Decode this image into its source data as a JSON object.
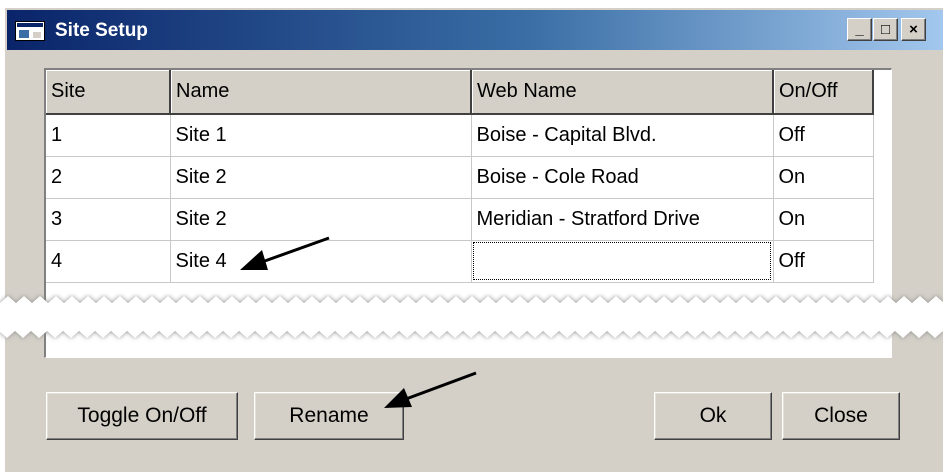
{
  "window": {
    "title": "Site Setup",
    "icon": "app-window-icon",
    "controls": {
      "minimize": "_",
      "maximize": "□",
      "close": "×"
    }
  },
  "grid": {
    "columns": [
      "Site",
      "Name",
      "Web Name",
      "On/Off"
    ],
    "rows": [
      {
        "site": "1",
        "name": "Site 1",
        "web_name": "Boise - Capital Blvd.",
        "on_off": "Off"
      },
      {
        "site": "2",
        "name": "Site 2",
        "web_name": "Boise - Cole Road",
        "on_off": "On"
      },
      {
        "site": "3",
        "name": "Site 2",
        "web_name": "Meridian - Stratford Drive",
        "on_off": "On"
      },
      {
        "site": "4",
        "name": "Site 4",
        "web_name": "",
        "on_off": "Off"
      }
    ]
  },
  "buttons": {
    "toggle": "Toggle On/Off",
    "rename": "Rename",
    "ok": "Ok",
    "close": "Close"
  },
  "colors": {
    "titlebar_start": "#0a246a",
    "titlebar_end": "#a6caf0",
    "face": "#d4d0c8"
  }
}
